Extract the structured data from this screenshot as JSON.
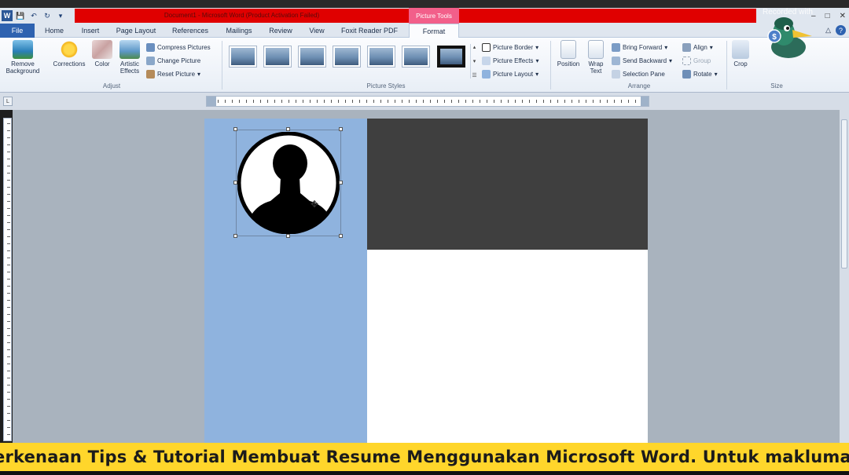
{
  "titlebar": {
    "document_title": "Document1 - Microsoft Word (Product Activation Failed)",
    "contextual_tab": "Picture Tools",
    "watermark": "Recorded with",
    "minimize": "–",
    "restore": "□",
    "close": "✕"
  },
  "qat": {
    "logo": "W",
    "save": "💾",
    "undo": "↶",
    "redo": "↻",
    "customize": "▾"
  },
  "tabs": [
    "File",
    "Home",
    "Insert",
    "Page Layout",
    "References",
    "Mailings",
    "Review",
    "View",
    "Foxit Reader PDF",
    "Format"
  ],
  "ribbon": {
    "adjust": {
      "remove_background": "Remove Background",
      "corrections": "Corrections",
      "color": "Color",
      "artistic_effects": "Artistic Effects",
      "compress_pictures": "Compress Pictures",
      "change_picture": "Change Picture",
      "reset_picture": "Reset Picture",
      "label": "Adjust"
    },
    "picture_styles": {
      "label": "Picture Styles",
      "picture_border": "Picture Border",
      "picture_effects": "Picture Effects",
      "picture_layout": "Picture Layout"
    },
    "arrange": {
      "label": "Arrange",
      "position": "Position",
      "wrap_text": "Wrap Text",
      "bring_forward": "Bring Forward",
      "send_backward": "Send Backward",
      "selection_pane": "Selection Pane",
      "align": "Align",
      "group": "Group",
      "rotate": "Rotate"
    },
    "size": {
      "label": "Size",
      "crop": "Crop"
    }
  },
  "colors": {
    "sidebar": "#8fb3de",
    "header_block": "#3f3f3f",
    "caption_bg": "#ffd62b",
    "file_tab": "#2e62b0",
    "picture_tools": "#f25f8a"
  },
  "caption": "erkenaan Tips & Tutorial Membuat Resume Menggunakan Microsoft Word. Untuk maklumat"
}
